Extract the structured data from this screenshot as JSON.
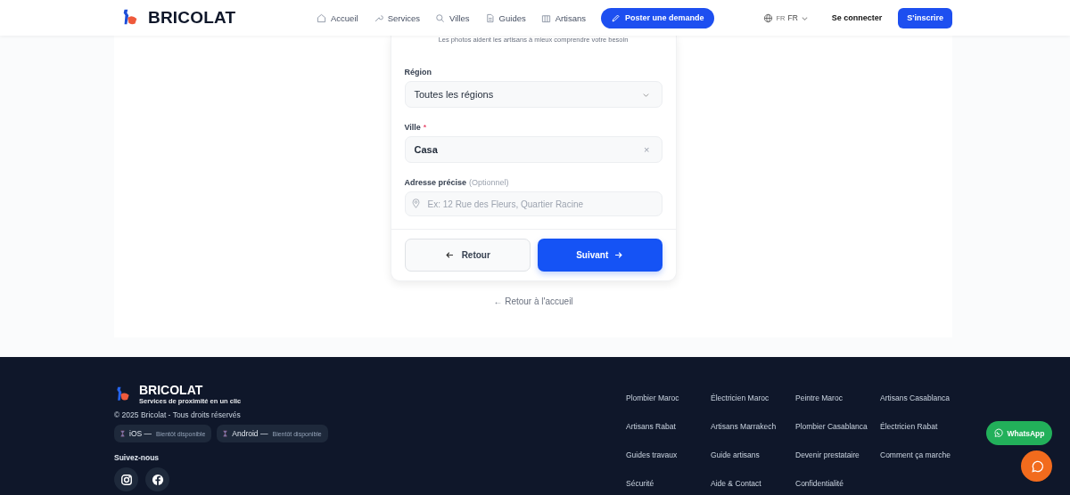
{
  "header": {
    "brand": "BRICOLAT",
    "nav": [
      {
        "label": "Accueil"
      },
      {
        "label": "Services"
      },
      {
        "label": "Villes"
      },
      {
        "label": "Guides"
      },
      {
        "label": "Artisans"
      }
    ],
    "post_button": "Poster une demande",
    "language": {
      "flag": "FR",
      "code": "FR"
    },
    "login": "Se connecter",
    "signup": "S'inscrire"
  },
  "form": {
    "hint": "Les photos aident les artisans à mieux comprendre votre besoin",
    "fields": [
      {
        "kind": "select",
        "label": "Région",
        "value": "Toutes les régions"
      },
      {
        "kind": "text",
        "label": "Ville",
        "required_mark": "*",
        "value": "Casa",
        "clear": "×"
      },
      {
        "kind": "address",
        "label": "Adresse précise",
        "note": "(Optionnel)",
        "placeholder": "Ex: 12 Rue des Fleurs, Quartier Racine"
      }
    ],
    "back_button": "Retour",
    "next_button": "Suivant",
    "home_link": "← Retour à l'accueil"
  },
  "footer": {
    "brand": "BRICOLAT",
    "tagline": "Services de proximité en un clic",
    "copyright": "© 2025 Bricolat - Tous droits réservés",
    "apps": [
      {
        "name": "iOS —",
        "status": "Bientôt disponible"
      },
      {
        "name": "Android —",
        "status": "Bientôt disponible"
      }
    ],
    "follow_label": "Suivez-nous",
    "links": [
      "Plombier Maroc",
      "Électricien Maroc",
      "Peintre Maroc",
      "Artisans Casablanca",
      "Artisans Rabat",
      "Artisans Marrakech",
      "Plombier Casablanca",
      "Électricien Rabat",
      "Guides travaux",
      "Guide artisans",
      "Devenir prestataire",
      "Comment ça marche",
      "Sécurité",
      "Aide & Contact",
      "Confidentialité"
    ]
  },
  "whatsapp": "WhatsApp"
}
